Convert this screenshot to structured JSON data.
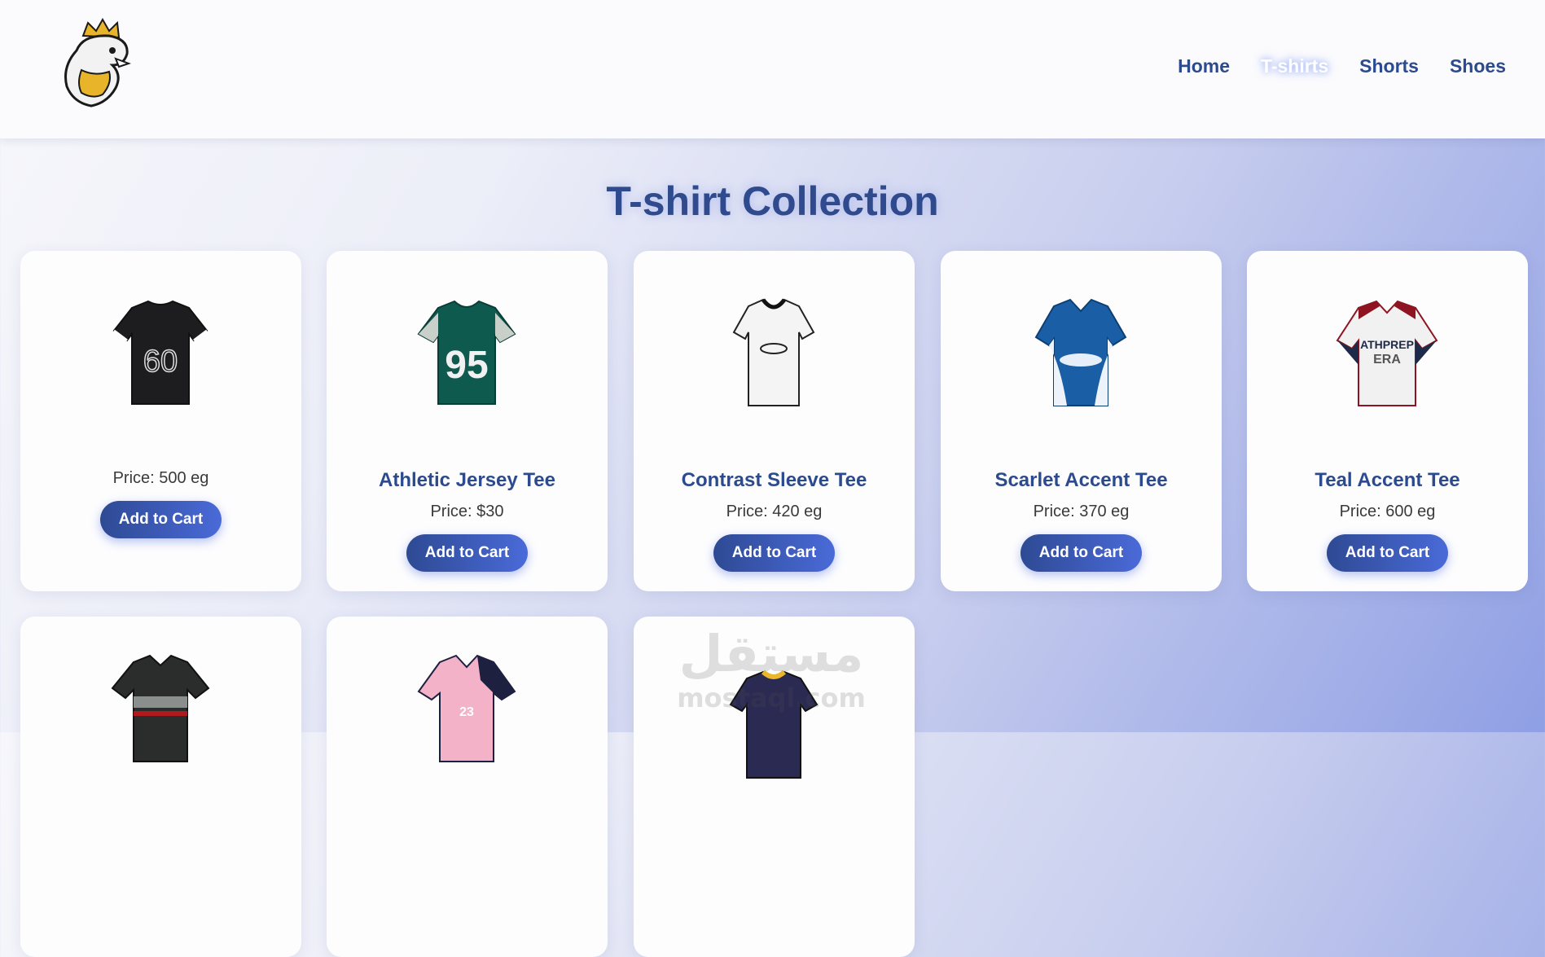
{
  "header": {
    "logo_icon": "cobra-king-logo-icon",
    "nav": [
      {
        "label": "Home",
        "active": false
      },
      {
        "label": "T-shirts",
        "active": true
      },
      {
        "label": "Shorts",
        "active": false
      },
      {
        "label": "Shoes",
        "active": false
      }
    ]
  },
  "page": {
    "title": "T-shirt Collection"
  },
  "products": [
    {
      "name": "",
      "price": "Price: 500 eg",
      "button": "Add to Cart",
      "color": "#1d1d1f"
    },
    {
      "name": "Athletic Jersey Tee",
      "price": "Price: $30",
      "button": "Add to Cart",
      "color": "#0f5a4f"
    },
    {
      "name": "Contrast Sleeve Tee",
      "price": "Price: 420 eg",
      "button": "Add to Cart",
      "color": "#f4f4f4"
    },
    {
      "name": "Scarlet Accent Tee",
      "price": "Price: 370 eg",
      "button": "Add to Cart",
      "color": "#1a5fa6"
    },
    {
      "name": "Teal Accent Tee",
      "price": "Price: 600 eg",
      "button": "Add to Cart",
      "color": "#f1f1f1"
    },
    {
      "name": "",
      "price": "",
      "button": "",
      "color": "#2a2d2c"
    },
    {
      "name": "",
      "price": "",
      "button": "",
      "color": "#f3b2c8"
    },
    {
      "name": "",
      "price": "",
      "button": "",
      "color": "#2b2a52"
    }
  ],
  "watermark": {
    "text": "mostaql.com",
    "arabic": "مستقل"
  }
}
